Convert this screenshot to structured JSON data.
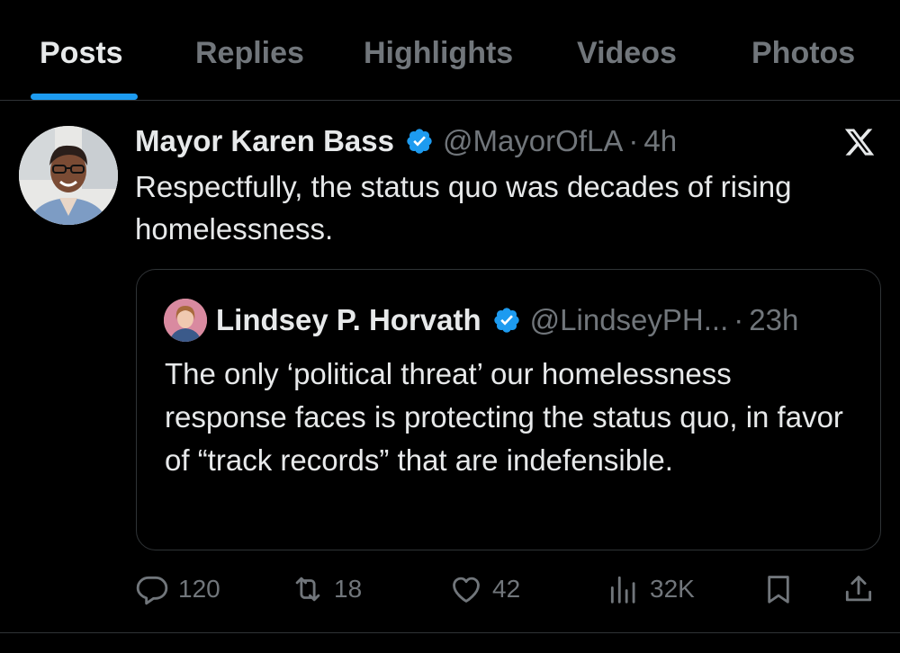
{
  "tabs": [
    {
      "label": "Posts",
      "active": true
    },
    {
      "label": "Replies",
      "active": false
    },
    {
      "label": "Highlights",
      "active": false
    },
    {
      "label": "Videos",
      "active": false
    },
    {
      "label": "Photos",
      "active": false
    }
  ],
  "tweet": {
    "author_name": "Mayor Karen Bass",
    "handle": "@MayorOfLA",
    "separator": "·",
    "time": "4h",
    "text": "Respectfully, the status quo was decades of rising homelessness.",
    "verified_icon": "verified-badge-icon",
    "platform_icon": "x-logo-icon"
  },
  "quote": {
    "author_name": "Lindsey P. Horvath",
    "handle": "@LindseyPH...",
    "separator": "·",
    "time": "23h",
    "text": "The only ‘political threat’ our homelessness response faces is protecting the status quo, in favor of “track records” that are indefensible."
  },
  "actions": {
    "replies": "120",
    "reposts": "18",
    "likes": "42",
    "views": "32K"
  },
  "colors": {
    "background": "#000000",
    "text_primary": "#e7e9ea",
    "text_secondary": "#71767b",
    "accent": "#1d9bf0",
    "border": "#2f3336"
  }
}
